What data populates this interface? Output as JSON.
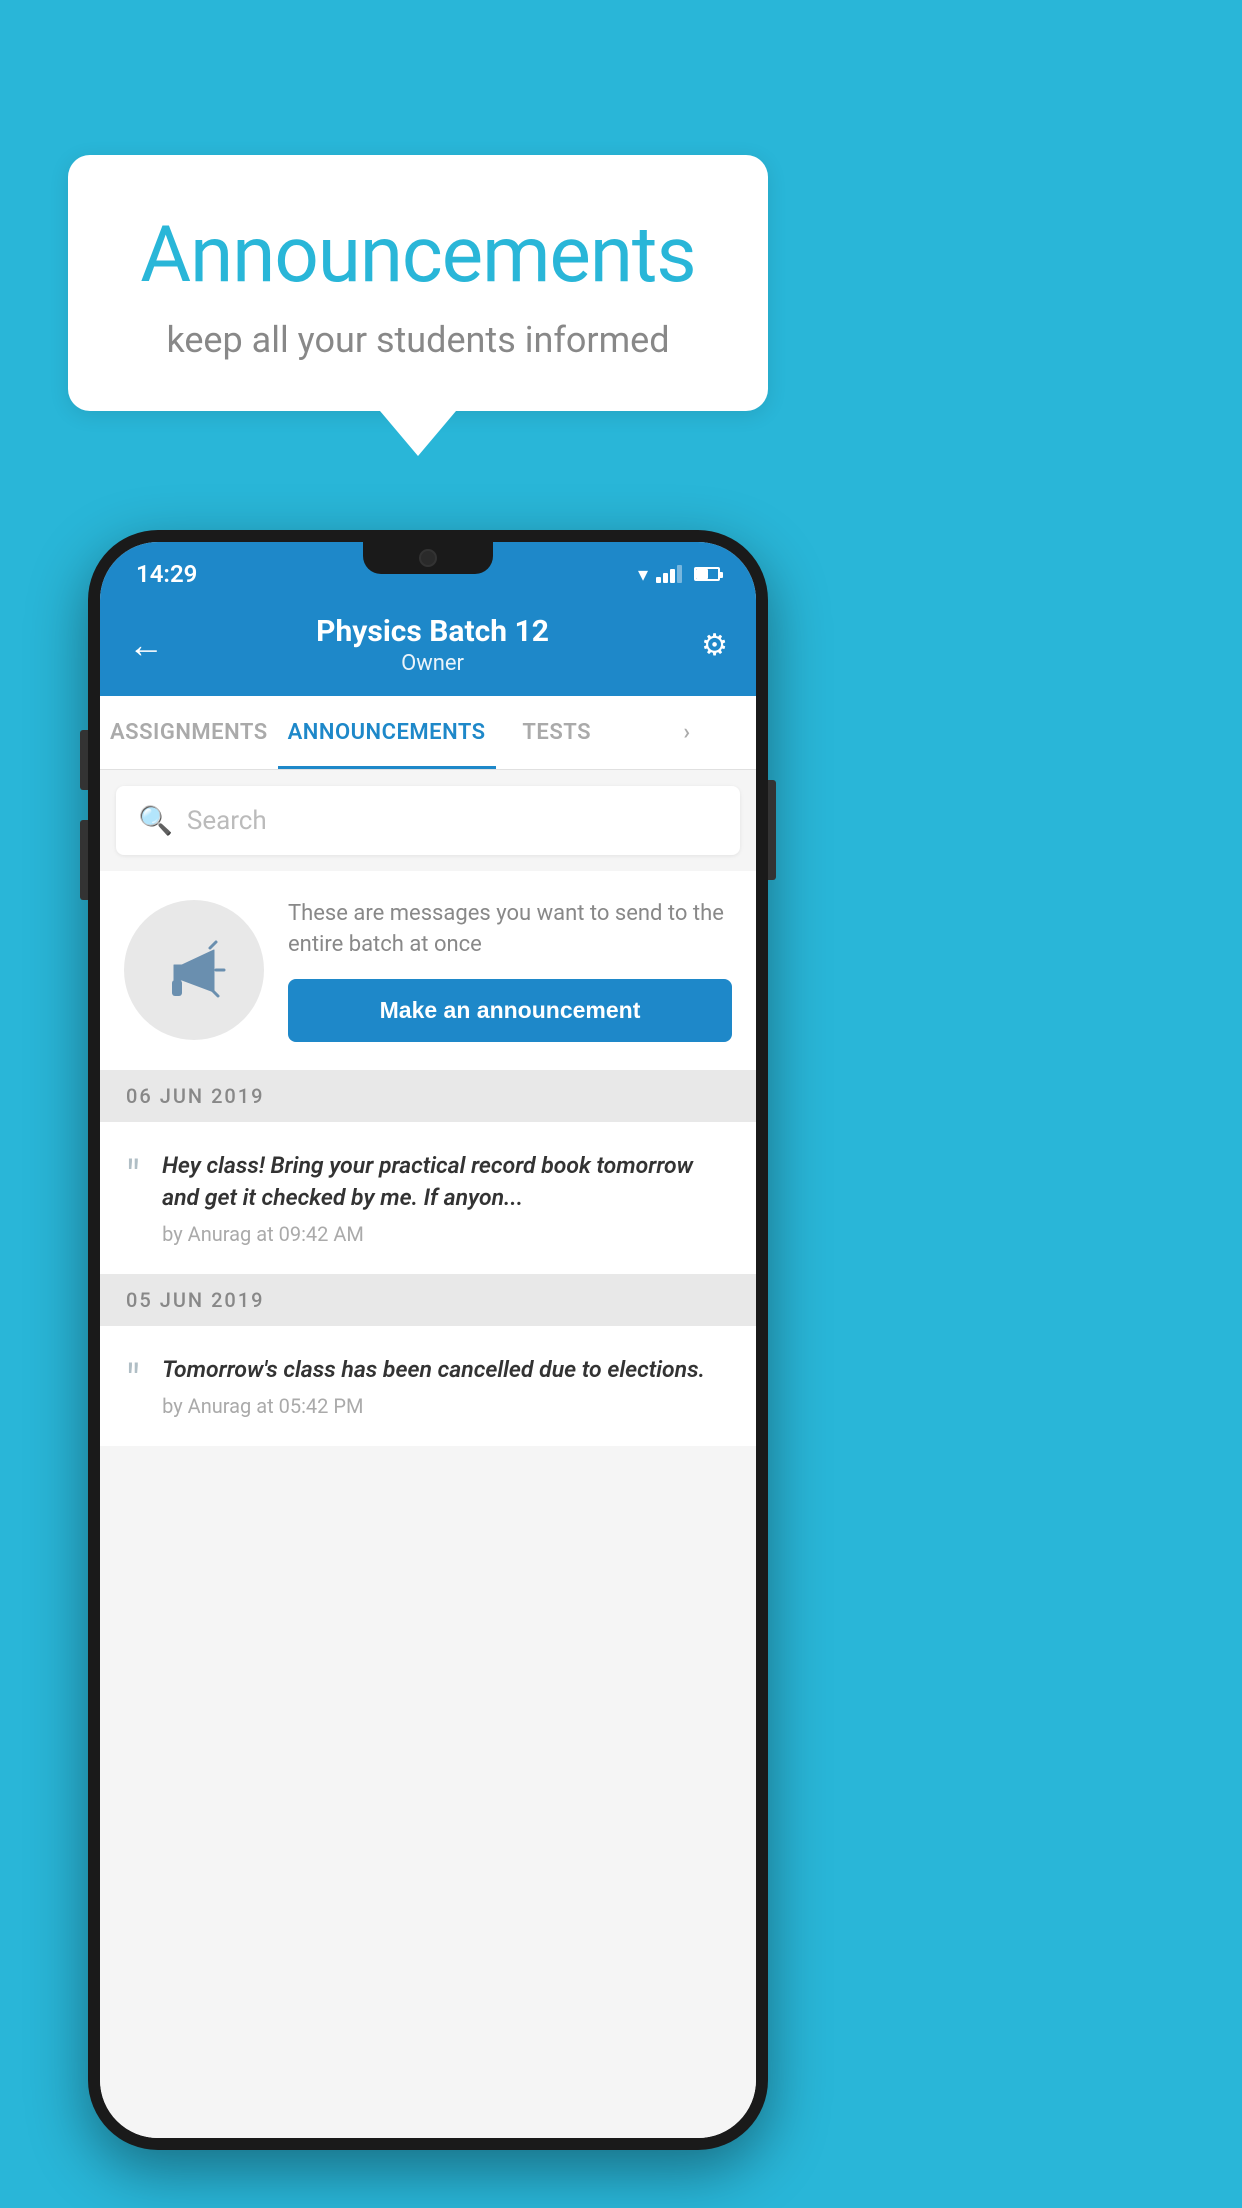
{
  "background_color": "#29b6d8",
  "speech_bubble": {
    "title": "Announcements",
    "subtitle": "keep all your students informed"
  },
  "phone": {
    "status_bar": {
      "time": "14:29"
    },
    "header": {
      "title": "Physics Batch 12",
      "subtitle": "Owner",
      "back_label": "←",
      "settings_label": "⚙"
    },
    "tabs": [
      {
        "label": "ASSIGNMENTS",
        "active": false
      },
      {
        "label": "ANNOUNCEMENTS",
        "active": true
      },
      {
        "label": "TESTS",
        "active": false
      },
      {
        "label": "›",
        "active": false
      }
    ],
    "search": {
      "placeholder": "Search"
    },
    "promo": {
      "description": "These are messages you want to send to the entire batch at once",
      "button_label": "Make an announcement"
    },
    "announcements": [
      {
        "date": "06  JUN  2019",
        "text": "Hey class! Bring your practical record book tomorrow and get it checked by me. If anyon...",
        "meta": "by Anurag at 09:42 AM"
      },
      {
        "date": "05  JUN  2019",
        "text": "Tomorrow's class has been cancelled due to elections.",
        "meta": "by Anurag at 05:42 PM"
      }
    ]
  }
}
